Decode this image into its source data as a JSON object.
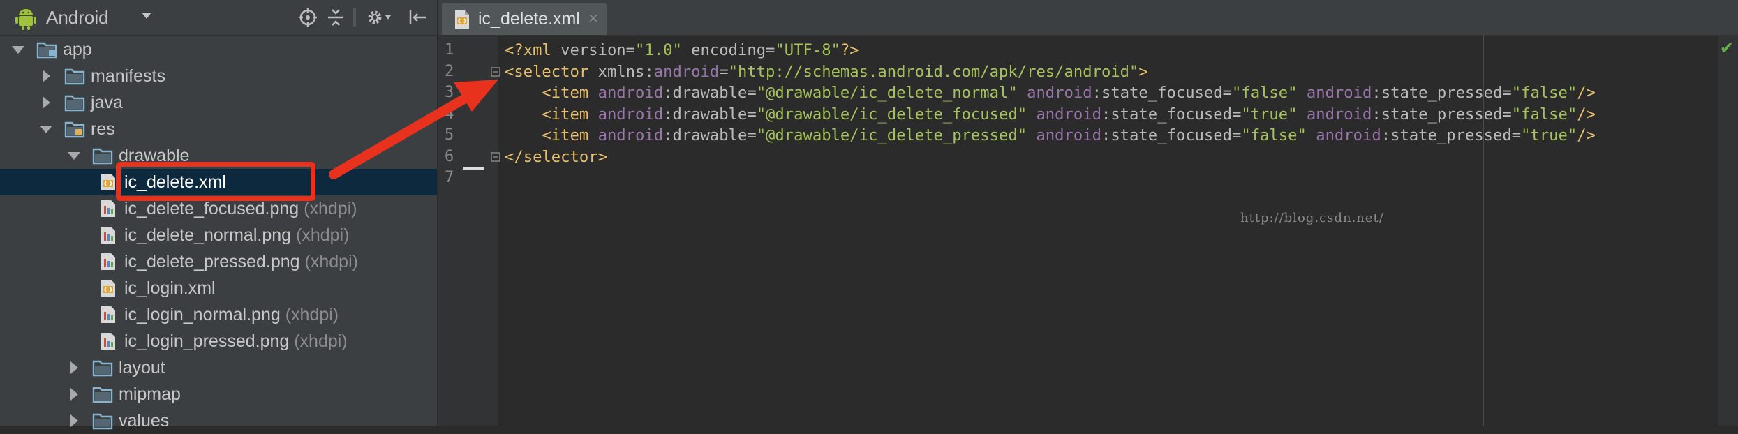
{
  "project_panel": {
    "view_label": "Android",
    "tree": [
      {
        "label": "app",
        "qualifier": "",
        "depth": 0,
        "expanded": true,
        "icon": "module-folder-icon",
        "bold": true
      },
      {
        "label": "manifests",
        "qualifier": "",
        "depth": 1,
        "expanded": false,
        "icon": "folder-icon"
      },
      {
        "label": "java",
        "qualifier": "",
        "depth": 1,
        "expanded": false,
        "icon": "folder-icon"
      },
      {
        "label": "res",
        "qualifier": "",
        "depth": 1,
        "expanded": true,
        "icon": "res-folder-icon"
      },
      {
        "label": "drawable",
        "qualifier": "",
        "depth": 2,
        "expanded": true,
        "icon": "folder-icon"
      },
      {
        "label": "ic_delete.xml",
        "qualifier": "",
        "depth": 3,
        "icon": "xml-file-icon",
        "selected": true
      },
      {
        "label": "ic_delete_focused.png",
        "qualifier": "(xhdpi)",
        "depth": 3,
        "icon": "png-file-icon"
      },
      {
        "label": "ic_delete_normal.png",
        "qualifier": "(xhdpi)",
        "depth": 3,
        "icon": "png-file-icon"
      },
      {
        "label": "ic_delete_pressed.png",
        "qualifier": "(xhdpi)",
        "depth": 3,
        "icon": "png-file-icon"
      },
      {
        "label": "ic_login.xml",
        "qualifier": "",
        "depth": 3,
        "icon": "xml-file-icon"
      },
      {
        "label": "ic_login_normal.png",
        "qualifier": "(xhdpi)",
        "depth": 3,
        "icon": "png-file-icon"
      },
      {
        "label": "ic_login_pressed.png",
        "qualifier": "(xhdpi)",
        "depth": 3,
        "icon": "png-file-icon"
      },
      {
        "label": "layout",
        "qualifier": "",
        "depth": 2,
        "expanded": false,
        "icon": "folder-icon"
      },
      {
        "label": "mipmap",
        "qualifier": "",
        "depth": 2,
        "expanded": false,
        "icon": "folder-icon"
      },
      {
        "label": "values",
        "qualifier": "",
        "depth": 2,
        "expanded": false,
        "icon": "folder-icon"
      }
    ]
  },
  "editor": {
    "tab_label": "ic_delete.xml",
    "tab_close": "×",
    "status_check": "✔",
    "watermark": "http://blog.csdn.net/",
    "line_numbers": [
      "1",
      "2",
      "3",
      "4",
      "5",
      "6",
      "7"
    ],
    "lines": [
      [
        [
          "t-tag",
          "<?xml "
        ],
        [
          "t-attr",
          "version="
        ],
        [
          "t-val",
          "\"1.0\""
        ],
        [
          "t-attr",
          " encoding="
        ],
        [
          "t-val",
          "\"UTF-8\""
        ],
        [
          "t-tag",
          "?>"
        ]
      ],
      [
        [
          "t-tag",
          "<selector "
        ],
        [
          "t-attr",
          "xmlns:"
        ],
        [
          "t-ns",
          "android"
        ],
        [
          "t-attr",
          "="
        ],
        [
          "t-val",
          "\"http://schemas.android.com/apk/res/android\""
        ],
        [
          "t-tag",
          ">"
        ]
      ],
      [
        [
          "t-tag",
          "    <item "
        ],
        [
          "t-ns",
          "android"
        ],
        [
          "t-attr",
          ":drawable="
        ],
        [
          "t-val",
          "\"@drawable/ic_delete_normal\""
        ],
        [
          "t-attr",
          " "
        ],
        [
          "t-ns",
          "android"
        ],
        [
          "t-attr",
          ":state_focused="
        ],
        [
          "t-val",
          "\"false\""
        ],
        [
          "t-attr",
          " "
        ],
        [
          "t-ns",
          "android"
        ],
        [
          "t-attr",
          ":state_pressed="
        ],
        [
          "t-val",
          "\"false\""
        ],
        [
          "t-tag",
          "/>"
        ]
      ],
      [
        [
          "t-tag",
          "    <item "
        ],
        [
          "t-ns",
          "android"
        ],
        [
          "t-attr",
          ":drawable="
        ],
        [
          "t-val",
          "\"@drawable/ic_delete_focused\""
        ],
        [
          "t-attr",
          " "
        ],
        [
          "t-ns",
          "android"
        ],
        [
          "t-attr",
          ":state_focused="
        ],
        [
          "t-val",
          "\"true\""
        ],
        [
          "t-attr",
          " "
        ],
        [
          "t-ns",
          "android"
        ],
        [
          "t-attr",
          ":state_pressed="
        ],
        [
          "t-val",
          "\"false\""
        ],
        [
          "t-tag",
          "/>"
        ]
      ],
      [
        [
          "t-tag",
          "    <item "
        ],
        [
          "t-ns",
          "android"
        ],
        [
          "t-attr",
          ":drawable="
        ],
        [
          "t-val",
          "\"@drawable/ic_delete_pressed\""
        ],
        [
          "t-attr",
          " "
        ],
        [
          "t-ns",
          "android"
        ],
        [
          "t-attr",
          ":state_focused="
        ],
        [
          "t-val",
          "\"false\""
        ],
        [
          "t-attr",
          " "
        ],
        [
          "t-ns",
          "android"
        ],
        [
          "t-attr",
          ":state_pressed="
        ],
        [
          "t-val",
          "\"true\""
        ],
        [
          "t-tag",
          "/>"
        ]
      ],
      [
        [
          "t-tag",
          "</selector>"
        ]
      ],
      []
    ]
  },
  "colors": {
    "annotation_red": "#e8321e",
    "selection_bg": "#0d293e",
    "xml_tag": "#e8bf6a",
    "xml_value": "#a5c25c",
    "xml_namespace": "#9876aa"
  }
}
